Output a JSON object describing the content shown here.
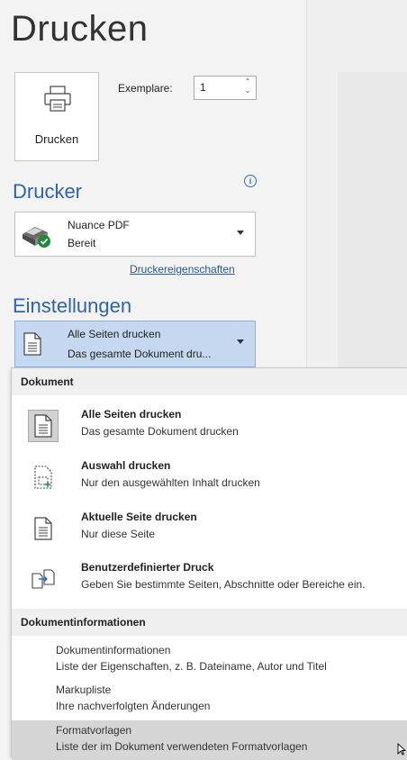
{
  "page": {
    "title": "Drucken"
  },
  "print_button": {
    "label": "Drucken"
  },
  "copies": {
    "label": "Exemplare:",
    "value": "1"
  },
  "printer_section": {
    "title": "Drucker",
    "selected_name": "Nuance PDF",
    "selected_status": "Bereit",
    "properties_link": "Druckereigenschaften"
  },
  "settings_section": {
    "title": "Einstellungen",
    "selected_title": "Alle Seiten drucken",
    "selected_desc": "Das gesamte Dokument dru..."
  },
  "menu": {
    "group1_header": "Dokument",
    "items": [
      {
        "title": "Alle Seiten drucken",
        "desc": "Das gesamte Dokument drucken",
        "icon": "pages-icon"
      },
      {
        "title": "Auswahl drucken",
        "desc": "Nur den ausgewählten Inhalt drucken",
        "icon": "selection-icon"
      },
      {
        "title": "Aktuelle Seite drucken",
        "desc": "Nur diese Seite",
        "icon": "page-icon"
      },
      {
        "title": "Benutzerdefinierter Druck",
        "desc": "Geben Sie bestimmte Seiten, Abschnitte oder Bereiche ein.",
        "icon": "custom-range-icon"
      }
    ],
    "group2_header": "Dokumentinformationen",
    "subitems": [
      {
        "title": "Dokumentinformationen",
        "desc": "Liste der Eigenschaften, z. B. Dateiname, Autor und Titel"
      },
      {
        "title": "Markupliste",
        "desc": "Ihre nachverfolgten Änderungen"
      },
      {
        "title": "Formatvorlagen",
        "desc": "Liste der im Dokument verwendeten Formatvorlagen"
      }
    ]
  },
  "colors": {
    "accent": "#2e63ad",
    "selection_bg": "#c5d8ef",
    "hover_bg": "#d6d6d6"
  }
}
